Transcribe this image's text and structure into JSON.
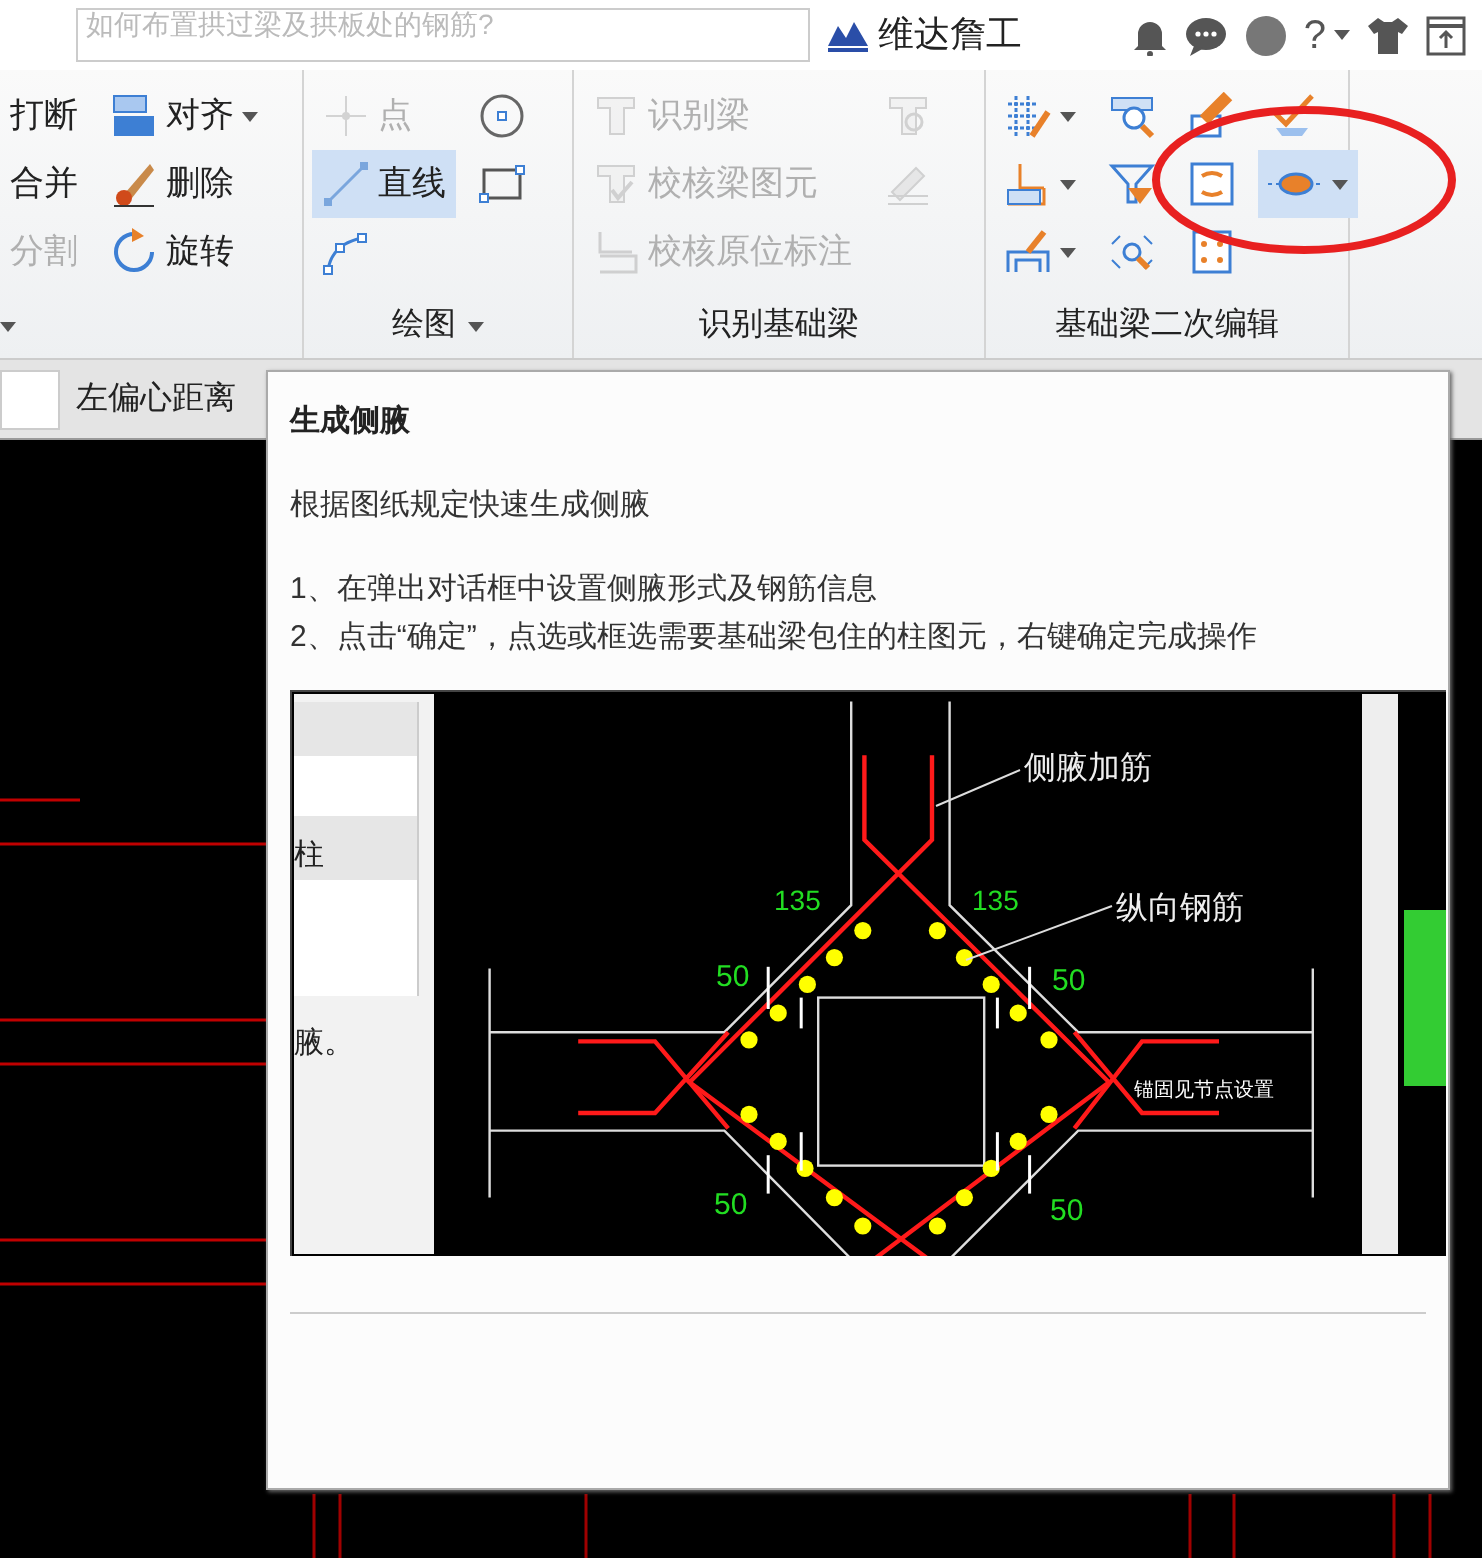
{
  "top_bar": {
    "search": {
      "value": "如何布置拱过梁及拱板处的钢筋?"
    },
    "brand": "维达詹工",
    "help": "?"
  },
  "ribbon": {
    "groups": [
      {
        "dropdown": true,
        "columns": [
          [
            {
              "label": "打断",
              "disabled": false,
              "selected": false,
              "dropdown": false
            },
            {
              "label": "合并",
              "disabled": false,
              "selected": false,
              "dropdown": false
            },
            {
              "label": "分割",
              "disabled": true,
              "selected": false,
              "dropdown": false
            }
          ],
          [
            {
              "label": "对齐",
              "disabled": false,
              "selected": false,
              "dropdown": true
            },
            {
              "label": "删除",
              "disabled": false,
              "selected": false,
              "dropdown": false
            },
            {
              "label": "旋转",
              "disabled": false,
              "selected": false,
              "dropdown": false
            }
          ]
        ]
      },
      {
        "label": "绘图",
        "dropdown": true,
        "columns": [
          [
            {
              "label": "点",
              "disabled": true,
              "selected": false,
              "dropdown": false
            },
            {
              "label": "直线",
              "disabled": false,
              "selected": true,
              "dropdown": false
            },
            {
              "disabled": false,
              "selected": false,
              "dropdown": false
            }
          ],
          [
            {
              "disabled": false,
              "selected": false,
              "dropdown": false
            },
            {
              "disabled": false,
              "selected": false,
              "dropdown": false
            }
          ]
        ]
      },
      {
        "label": "识别基础梁",
        "dropdown": false,
        "columns": [
          [
            {
              "label": "识别梁",
              "disabled": true,
              "selected": false,
              "dropdown": false
            },
            {
              "label": "校核梁图元",
              "disabled": true,
              "selected": false,
              "dropdown": false
            },
            {
              "label": "校核原位标注",
              "disabled": true,
              "selected": false,
              "dropdown": false
            }
          ],
          [
            {
              "disabled": true,
              "selected": false,
              "dropdown": false
            },
            {
              "disabled": true,
              "selected": false,
              "dropdown": false
            }
          ]
        ]
      },
      {
        "label": "基础梁二次编辑",
        "dropdown": false,
        "columns": [
          [
            {
              "disabled": false,
              "selected": false,
              "dropdown": true
            },
            {
              "disabled": false,
              "selected": false,
              "dropdown": true
            },
            {
              "disabled": false,
              "selected": false,
              "dropdown": true
            }
          ],
          [
            {
              "disabled": false,
              "selected": false,
              "dropdown": false
            },
            {
              "disabled": false,
              "selected": false,
              "dropdown": false
            },
            {
              "disabled": false,
              "selected": false,
              "dropdown": false
            }
          ],
          [
            {
              "disabled": false,
              "selected": false,
              "dropdown": false
            },
            {
              "disabled": false,
              "selected": false,
              "dropdown": false
            },
            {
              "disabled": false,
              "selected": false,
              "dropdown": false
            }
          ],
          [
            {
              "disabled": false,
              "selected": false,
              "dropdown": false
            },
            {
              "disabled": false,
              "selected": true,
              "dropdown": true
            }
          ]
        ]
      }
    ]
  },
  "property_bar": {
    "label": "左偏心距离"
  },
  "tooltip": {
    "title": "生成侧腋",
    "description": "根据图纸规定快速生成侧腋",
    "steps": [
      "1、在弹出对话框中设置侧腋形式及钢筋信息",
      "2、点击“确定”，点选或框选需要基础梁包住的柱图元，右键确定完成操作"
    ],
    "figure": {
      "dialog_row": "柱",
      "dialog_text": "腋。",
      "haunch_label": "侧腋加筋",
      "rebar_label": "纵向钢筋",
      "angles": [
        "135",
        "135"
      ],
      "spacings": [
        "50",
        "50",
        "50",
        "50"
      ],
      "anchor_note": "锚固见节点设置"
    }
  }
}
